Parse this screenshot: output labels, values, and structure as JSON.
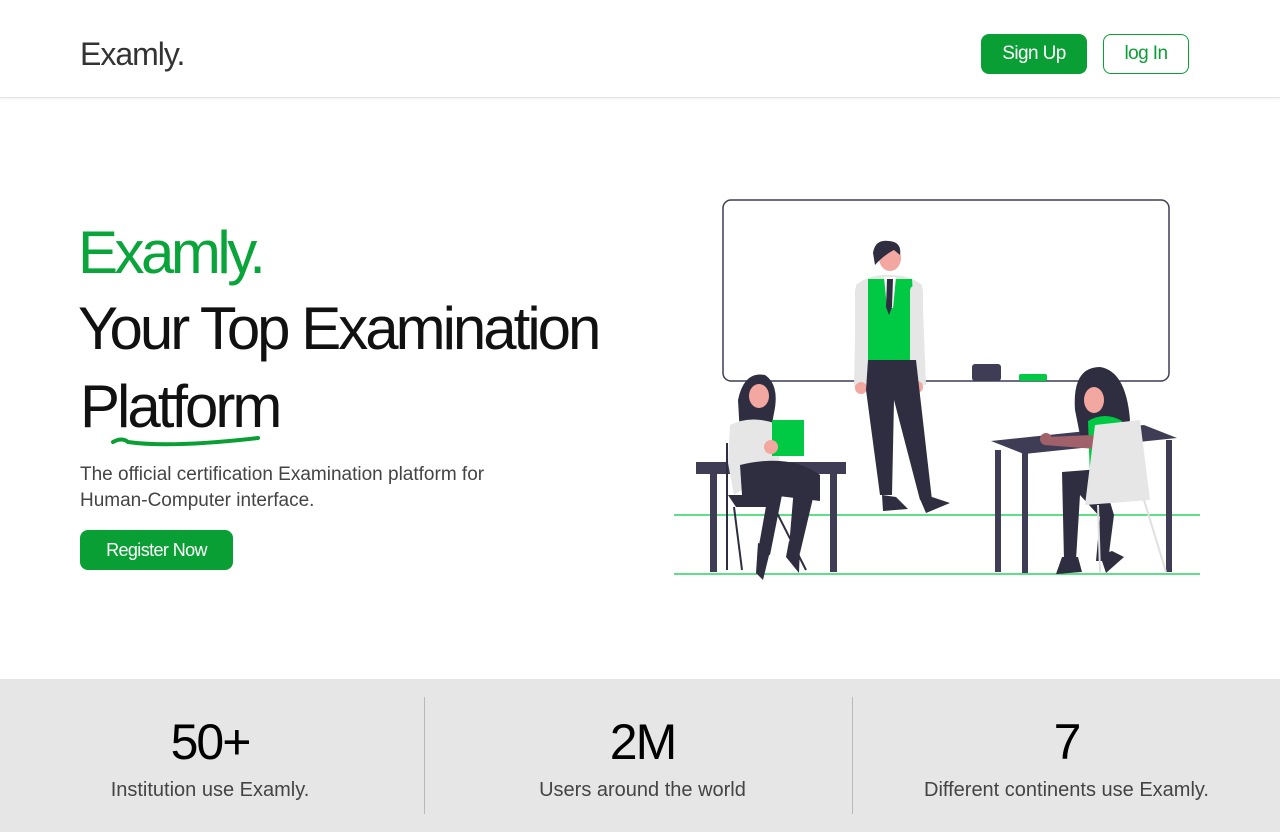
{
  "header": {
    "logo": "Examly.",
    "signup_label": "Sign Up",
    "login_label": "log In"
  },
  "hero": {
    "brand": "Examly.",
    "title_line1": "Your Top Examination",
    "title_line2": "Platform",
    "description": "The official certification Examination platform for Human-Computer interface.",
    "register_label": "Register Now"
  },
  "stats": [
    {
      "value": "50+",
      "label": "Institution use Examly."
    },
    {
      "value": "2M",
      "label": "Users around the world"
    },
    {
      "value": "7",
      "label": "Different continents use Examly."
    }
  ],
  "colors": {
    "accent": "#0a9f34",
    "brand_text": "#0aa53a",
    "stats_background": "#e6e6e6",
    "illustration_dark": "#3f3d56",
    "illustration_green": "#00c944"
  }
}
